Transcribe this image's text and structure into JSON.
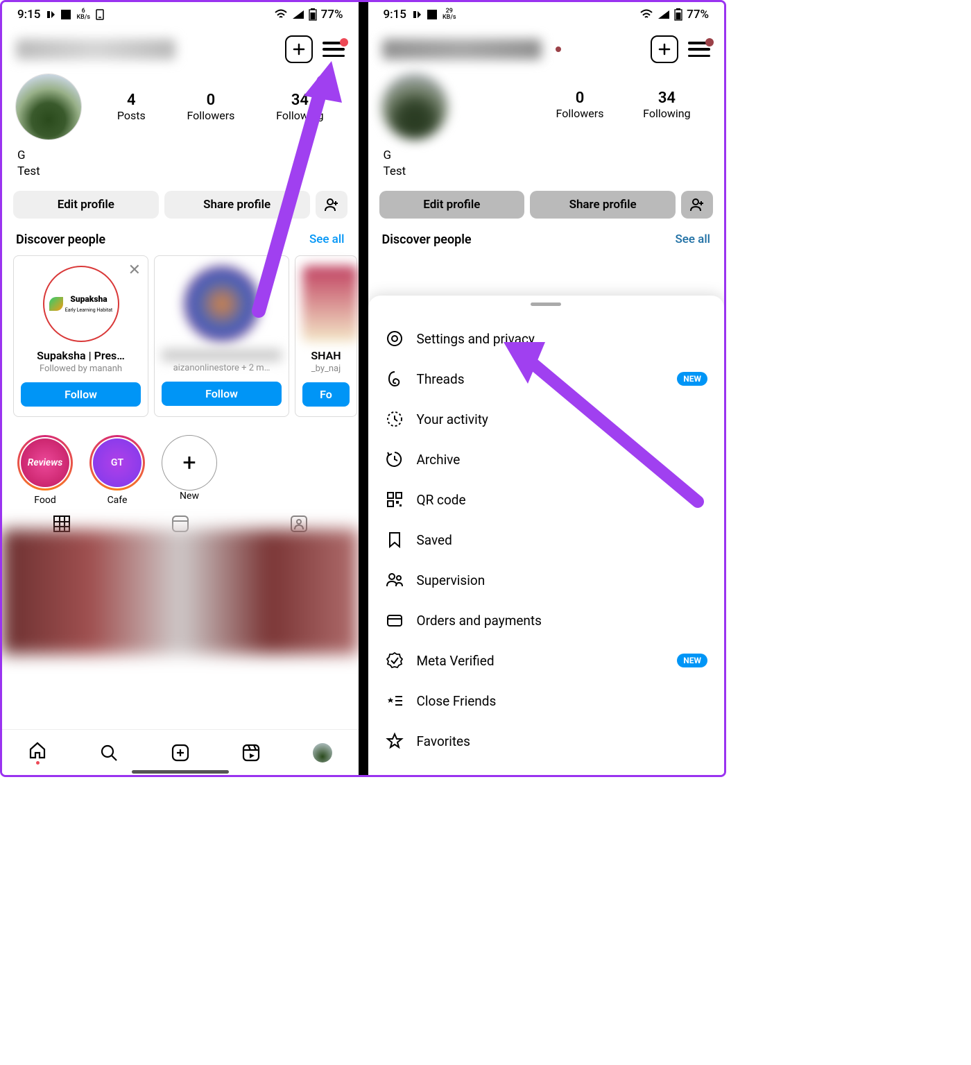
{
  "status": {
    "time": "9:15",
    "kbs_left": "6",
    "kbs_right": "29",
    "kbs_unit": "KB/s",
    "battery": "77%"
  },
  "profile": {
    "name": "G",
    "bio": "Test",
    "stats": [
      {
        "n": "4",
        "l": "Posts"
      },
      {
        "n": "0",
        "l": "Followers"
      },
      {
        "n": "34",
        "l": "Following"
      }
    ],
    "stats_right": [
      {
        "n": "0",
        "l": "Followers"
      },
      {
        "n": "34",
        "l": "Following"
      }
    ],
    "edit": "Edit profile",
    "share": "Share profile"
  },
  "discover": {
    "title": "Discover people",
    "see": "See all"
  },
  "cards": [
    {
      "name": "Supaksha | Pres…",
      "sub": "Followed by mananh",
      "logo": "Supaksha",
      "tag": "Early Learning Habitat"
    },
    {
      "name": "",
      "sub": "aizanonlinestore + 2 m…"
    },
    {
      "name": "SHAH",
      "sub": "_by_naj"
    }
  ],
  "follow": "Follow",
  "highlights": [
    {
      "l": "Food",
      "txt": "Reviews"
    },
    {
      "l": "Cafe",
      "txt": "GT"
    },
    {
      "l": "New"
    }
  ],
  "menu": [
    {
      "icon": "settings",
      "label": "Settings and privacy"
    },
    {
      "icon": "threads",
      "label": "Threads",
      "badge": "NEW"
    },
    {
      "icon": "activity",
      "label": "Your activity"
    },
    {
      "icon": "archive",
      "label": "Archive"
    },
    {
      "icon": "qr",
      "label": "QR code"
    },
    {
      "icon": "saved",
      "label": "Saved"
    },
    {
      "icon": "supervision",
      "label": "Supervision"
    },
    {
      "icon": "orders",
      "label": "Orders and payments"
    },
    {
      "icon": "verified",
      "label": "Meta Verified",
      "badge": "NEW"
    },
    {
      "icon": "close-friends",
      "label": "Close Friends"
    },
    {
      "icon": "favorites",
      "label": "Favorites"
    }
  ]
}
